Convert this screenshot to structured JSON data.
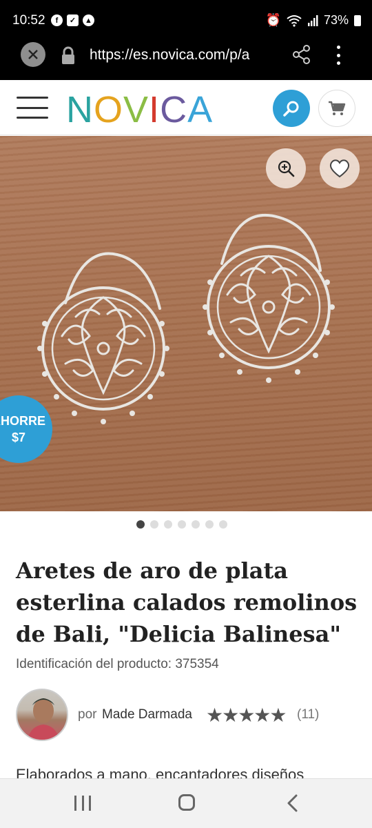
{
  "status_bar": {
    "time": "10:52",
    "battery": "73%",
    "left_icons": [
      "facebook-icon",
      "check-icon",
      "app-icon"
    ],
    "right_icons": [
      "alarm-icon",
      "wifi-icon",
      "signal-icon",
      "battery-icon"
    ]
  },
  "browser": {
    "url": "https://es.novica.com/p/a",
    "icons": [
      "close-icon",
      "lock-icon",
      "share-icon",
      "more-icon"
    ]
  },
  "header": {
    "logo_letters": [
      "N",
      "O",
      "V",
      "I",
      "C",
      "A"
    ],
    "icons": [
      "menu-icon",
      "search-icon",
      "cart-icon"
    ],
    "accent_color": "#2e9fd6"
  },
  "hero": {
    "savings_line1": "AHORRE",
    "savings_line2": "$7",
    "icons": [
      "zoom-icon",
      "heart-icon"
    ],
    "carousel": {
      "total": 7,
      "active": 1
    }
  },
  "product": {
    "title": "Aretes de aro de plata esterlina calados remolinos de Bali, \"Delicia Balinesa\"",
    "id_label": "Identificación del producto:",
    "id_value": "375354",
    "artisan_prefix": "por",
    "artisan_name": "Made Darmada",
    "rating_stars": "★★★★★",
    "rating": 5,
    "review_count": "(11)",
    "description_start": "Elaborados a mano, encantadores diseños"
  },
  "nav": {
    "icons": [
      "recent-apps-icon",
      "home-icon",
      "back-icon"
    ]
  }
}
